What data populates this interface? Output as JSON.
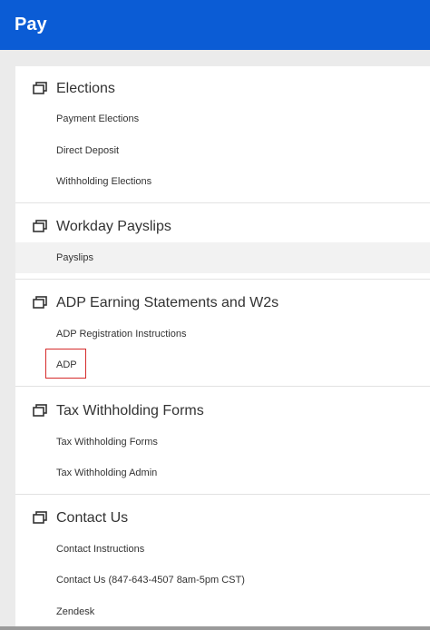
{
  "header": {
    "title": "Pay"
  },
  "sections": [
    {
      "title": "Elections",
      "icon": "stacked-windows-icon",
      "links": [
        {
          "label": "Payment Elections"
        },
        {
          "label": "Direct Deposit"
        },
        {
          "label": "Withholding Elections"
        }
      ]
    },
    {
      "title": "Workday Payslips",
      "icon": "stacked-windows-icon",
      "links": [
        {
          "label": "Payslips"
        }
      ]
    },
    {
      "title": "ADP Earning Statements and W2s",
      "icon": "stacked-windows-icon",
      "links": [
        {
          "label": "ADP Registration Instructions"
        },
        {
          "label": "ADP"
        }
      ]
    },
    {
      "title": "Tax Withholding Forms",
      "icon": "stacked-windows-icon",
      "links": [
        {
          "label": "Tax Withholding Forms"
        },
        {
          "label": "Tax Withholding Admin"
        }
      ]
    },
    {
      "title": "Contact Us",
      "icon": "stacked-windows-icon",
      "links": [
        {
          "label": "Contact Instructions"
        },
        {
          "label": "Contact Us (847-643-4507 8am-5pm CST)"
        },
        {
          "label": "Zendesk"
        }
      ]
    }
  ],
  "colors": {
    "header_bg": "#0b5cd5",
    "page_bg": "#ebebeb",
    "highlight_box": "#d62a2a"
  }
}
